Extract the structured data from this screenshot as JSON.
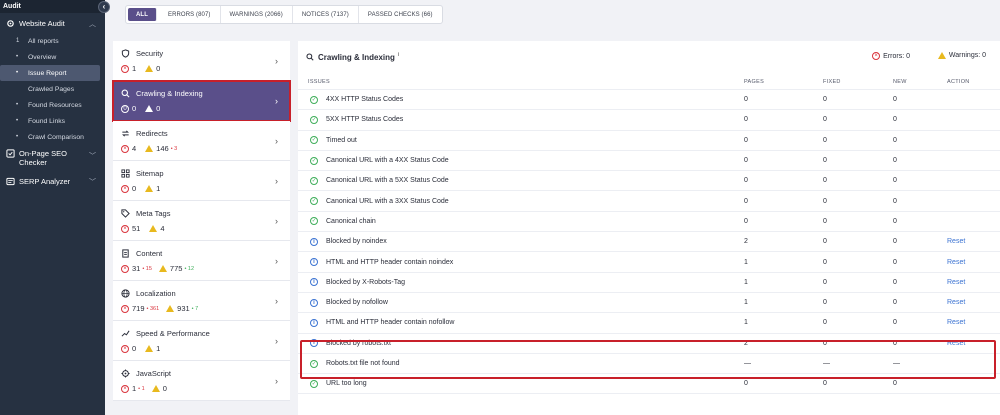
{
  "sidebar": {
    "header": "Audit",
    "collapse_icon": "chevron-left-icon",
    "website_audit": "Website Audit",
    "items": [
      {
        "label": "All reports",
        "marker": "1"
      },
      {
        "label": "Overview",
        "marker": "•"
      },
      {
        "label": "Issue Report",
        "marker": "•"
      },
      {
        "label": "Crawled Pages",
        "marker": ""
      },
      {
        "label": "Found Resources",
        "marker": "•"
      },
      {
        "label": "Found Links",
        "marker": "•"
      },
      {
        "label": "Crawl Comparison",
        "marker": "•"
      }
    ],
    "onpage": "On-Page SEO Checker",
    "serp": "SERP Analyzer"
  },
  "tabs": [
    "ALL",
    "ERRORS (807)",
    "WARNINGS (2066)",
    "NOTICES (7137)",
    "PASSED CHECKS (66)"
  ],
  "categories": [
    {
      "name": "Security",
      "icon": "shield-icon",
      "errors": "1",
      "warnings": "0",
      "err_delta": "",
      "warn_delta": ""
    },
    {
      "name": "Crawling & Indexing",
      "icon": "search-icon",
      "errors": "0",
      "warnings": "0",
      "err_delta": "",
      "warn_delta": ""
    },
    {
      "name": "Redirects",
      "icon": "redirect-icon",
      "errors": "4",
      "warnings": "146",
      "err_delta": "",
      "warn_delta": "• 3"
    },
    {
      "name": "Sitemap",
      "icon": "sitemap-icon",
      "errors": "0",
      "warnings": "1",
      "err_delta": "",
      "warn_delta": ""
    },
    {
      "name": "Meta Tags",
      "icon": "tag-icon",
      "errors": "51",
      "warnings": "4",
      "err_delta": "",
      "warn_delta": ""
    },
    {
      "name": "Content",
      "icon": "document-icon",
      "errors": "31",
      "warnings": "775",
      "err_delta": "• 15",
      "warn_delta": "• 12"
    },
    {
      "name": "Localization",
      "icon": "globe-icon",
      "errors": "719",
      "warnings": "931",
      "err_delta": "• 361",
      "warn_delta": "• 7"
    },
    {
      "name": "Speed & Performance",
      "icon": "trend-icon",
      "errors": "0",
      "warnings": "1",
      "err_delta": "",
      "warn_delta": ""
    },
    {
      "name": "JavaScript",
      "icon": "javascript-icon",
      "errors": "1",
      "warnings": "0",
      "err_delta": "• 1",
      "warn_delta": ""
    }
  ],
  "panel": {
    "title": "Crawling & Indexing",
    "sup": "i",
    "errors_label": "Errors: 0",
    "warnings_label": "Warnings: 0",
    "columns": [
      "ISSUES",
      "PAGES",
      "FIXED",
      "NEW",
      "ACTION"
    ],
    "rows": [
      {
        "status": "ok",
        "issue": "4XX HTTP Status Codes",
        "pages": "0",
        "fixed": "0",
        "new": "0",
        "action": ""
      },
      {
        "status": "ok",
        "issue": "5XX HTTP Status Codes",
        "pages": "0",
        "fixed": "0",
        "new": "0",
        "action": ""
      },
      {
        "status": "ok",
        "issue": "Timed out",
        "pages": "0",
        "fixed": "0",
        "new": "0",
        "action": ""
      },
      {
        "status": "ok",
        "issue": "Canonical URL with a 4XX Status Code",
        "pages": "0",
        "fixed": "0",
        "new": "0",
        "action": ""
      },
      {
        "status": "ok",
        "issue": "Canonical URL with a 5XX Status Code",
        "pages": "0",
        "fixed": "0",
        "new": "0",
        "action": ""
      },
      {
        "status": "ok",
        "issue": "Canonical URL with a 3XX Status Code",
        "pages": "0",
        "fixed": "0",
        "new": "0",
        "action": ""
      },
      {
        "status": "ok",
        "issue": "Canonical chain",
        "pages": "0",
        "fixed": "0",
        "new": "0",
        "action": ""
      },
      {
        "status": "info",
        "issue": "Blocked by noindex",
        "pages": "2",
        "fixed": "0",
        "new": "0",
        "action": "Reset"
      },
      {
        "status": "info",
        "issue": "HTML and HTTP header contain noindex",
        "pages": "1",
        "fixed": "0",
        "new": "0",
        "action": "Reset"
      },
      {
        "status": "info",
        "issue": "Blocked by X-Robots-Tag",
        "pages": "1",
        "fixed": "0",
        "new": "0",
        "action": "Reset"
      },
      {
        "status": "info",
        "issue": "Blocked by nofollow",
        "pages": "1",
        "fixed": "0",
        "new": "0",
        "action": "Reset"
      },
      {
        "status": "info",
        "issue": "HTML and HTTP header contain nofollow",
        "pages": "1",
        "fixed": "0",
        "new": "0",
        "action": "Reset"
      },
      {
        "status": "info",
        "issue": "Blocked by robots.txt",
        "pages": "2",
        "fixed": "0",
        "new": "0",
        "action": "Reset"
      },
      {
        "status": "ok",
        "issue": "Robots.txt file not found",
        "pages": "—",
        "fixed": "—",
        "new": "—",
        "action": ""
      },
      {
        "status": "ok",
        "issue": "URL too long",
        "pages": "0",
        "fixed": "0",
        "new": "0",
        "action": ""
      }
    ]
  }
}
